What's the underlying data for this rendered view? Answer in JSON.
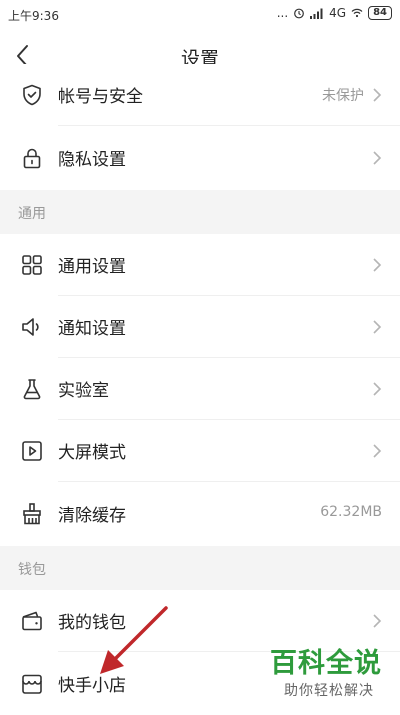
{
  "status_bar": {
    "time": "上午9:36",
    "dots": "...",
    "network": "4G",
    "battery": "84"
  },
  "header": {
    "title": "设置",
    "back_icon": "chevron-left-icon"
  },
  "rows": [
    {
      "label": "帐号与安全",
      "value": "未保护",
      "icon": "shield-icon",
      "arrow": true
    },
    {
      "label": "隐私设置",
      "value": "",
      "icon": "lock-icon",
      "arrow": true
    },
    {
      "label": "通用设置",
      "value": "",
      "icon": "grid-icon",
      "arrow": true
    },
    {
      "label": "通知设置",
      "value": "",
      "icon": "speaker-icon",
      "arrow": true
    },
    {
      "label": "实验室",
      "value": "",
      "icon": "flask-icon",
      "arrow": true
    },
    {
      "label": "大屏模式",
      "value": "",
      "icon": "play-screen-icon",
      "arrow": true
    },
    {
      "label": "清除缓存",
      "value": "62.32MB",
      "icon": "broom-icon",
      "arrow": false
    },
    {
      "label": "我的钱包",
      "value": "",
      "icon": "wallet-icon",
      "arrow": true
    },
    {
      "label": "快手小店",
      "value": "",
      "icon": "store-icon",
      "arrow": false
    }
  ],
  "sections": {
    "general": "通用",
    "wallet": "钱包"
  },
  "watermark": {
    "title": "百科全说",
    "subtitle": "助你轻松解决"
  },
  "colors": {
    "accent_arrow": "#c0282b",
    "watermark_green": "#2e9b3c"
  }
}
